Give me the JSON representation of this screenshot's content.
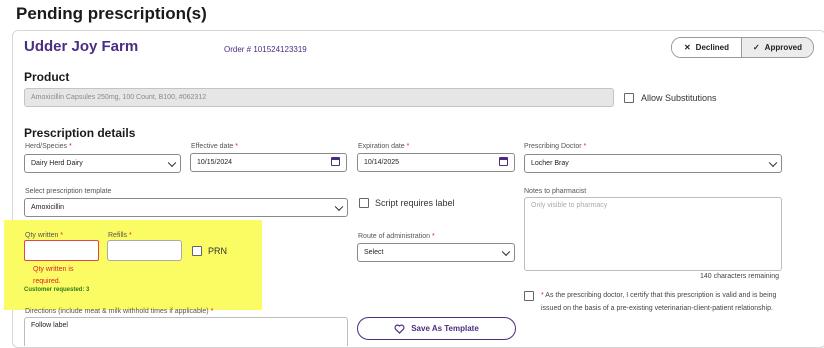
{
  "page_title": "Pending prescription(s)",
  "farm_name": "Udder Joy Farm",
  "order_number": "Order # 101524123319",
  "status_toggle": {
    "declined": "Declined",
    "approved": "Approved",
    "selected": "Approved"
  },
  "product": {
    "heading": "Product",
    "value": "Amoxicillin Capsules 250mg, 100 Count, B100, #062312",
    "allow_substitutions": "Allow Substitutions",
    "allow_substitutions_checked": false
  },
  "prescription_details": {
    "heading": "Prescription details",
    "herd_species": {
      "label": "Herd/Species",
      "value": "Dairy Herd Dairy"
    },
    "effective_date": {
      "label": "Effective date",
      "value": "10/15/2024"
    },
    "expiration_date": {
      "label": "Expiration date",
      "value": "10/14/2025"
    },
    "prescribing_doctor": {
      "label": "Prescribing Doctor",
      "value": "Locher Bray"
    },
    "template": {
      "label": "Select prescription template",
      "value": "Amoxicillin"
    },
    "script_requires_label": "Script requires label",
    "notes": {
      "label": "Notes to pharmacist",
      "placeholder": "Only visible to pharmacy",
      "remaining": "140 characters remaining"
    },
    "qty_written": {
      "label": "Qty written",
      "error_line1": "Qty written is",
      "error_line2": "required.",
      "customer_requested": "Customer requested: 3",
      "value": ""
    },
    "refills": {
      "label": "Refills",
      "value": ""
    },
    "prn": "PRN",
    "route": {
      "label": "Route of administration",
      "value": "Select"
    },
    "directions": {
      "label": "Directions (include meat & milk withhold times if applicable)",
      "value": "Follow label"
    },
    "save_template": "Save As Template",
    "certification": "As the prescribing doctor, I certify that this prescription is valid and is being issued on the basis of a pre-existing veterinarian-client-patient relationship.",
    "required_mark": "*"
  },
  "colors": {
    "brand": "#4b2d83",
    "error": "#d9262a",
    "highlight": "#fbfb63",
    "success": "#2f7d1e"
  }
}
